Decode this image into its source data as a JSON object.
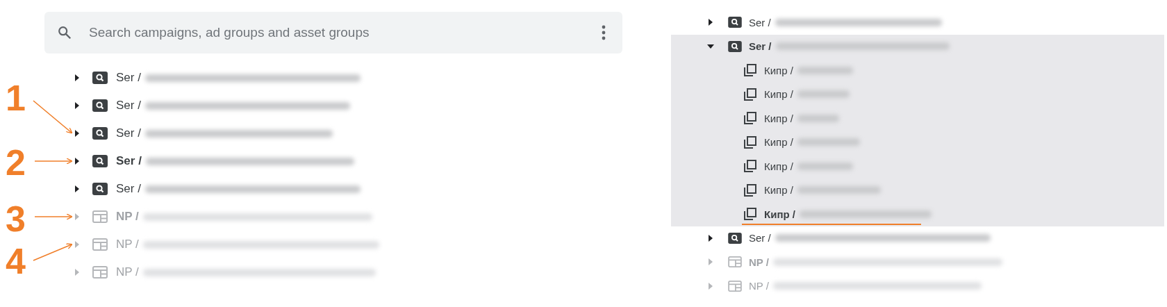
{
  "left_panel": {
    "search": {
      "placeholder": "Search campaigns, ad groups and asset groups"
    },
    "rows": [
      {
        "kind": "search",
        "prefix": "Ser /",
        "bold": false,
        "disabled": false,
        "expanded": false,
        "selected": false
      },
      {
        "kind": "search",
        "prefix": "Ser /",
        "bold": false,
        "disabled": false,
        "expanded": false,
        "selected": false
      },
      {
        "kind": "search",
        "prefix": "Ser /",
        "bold": false,
        "disabled": false,
        "expanded": false,
        "selected": false
      },
      {
        "kind": "search",
        "prefix": "Ser /",
        "bold": true,
        "disabled": false,
        "expanded": false,
        "selected": false
      },
      {
        "kind": "search",
        "prefix": "Ser /",
        "bold": false,
        "disabled": false,
        "expanded": false,
        "selected": false
      },
      {
        "kind": "display",
        "prefix": "NP /",
        "bold": true,
        "disabled": true,
        "expanded": false,
        "selected": false
      },
      {
        "kind": "display",
        "prefix": "NP /",
        "bold": false,
        "disabled": true,
        "expanded": false,
        "selected": false
      },
      {
        "kind": "display",
        "prefix": "NP /",
        "bold": false,
        "disabled": true,
        "expanded": false,
        "selected": false
      }
    ]
  },
  "annotations": [
    {
      "label": "1"
    },
    {
      "label": "2"
    },
    {
      "label": "3"
    },
    {
      "label": "4"
    }
  ],
  "right_panel": {
    "rows": [
      {
        "kind": "search",
        "prefix": "Ser /",
        "bold": false,
        "disabled": false,
        "expanded": false,
        "selected": false
      },
      {
        "kind": "search",
        "prefix": "Ser /",
        "bold": true,
        "disabled": false,
        "expanded": true,
        "selected": true,
        "children": [
          {
            "prefix": "Кипр /",
            "bold": false,
            "underlined": false
          },
          {
            "prefix": "Кипр /",
            "bold": false,
            "underlined": false
          },
          {
            "prefix": "Кипр /",
            "bold": false,
            "underlined": false
          },
          {
            "prefix": "Кипр /",
            "bold": false,
            "underlined": false
          },
          {
            "prefix": "Кипр /",
            "bold": false,
            "underlined": false
          },
          {
            "prefix": "Кипр /",
            "bold": false,
            "underlined": false
          },
          {
            "prefix": "Кипр /",
            "bold": true,
            "underlined": true
          }
        ]
      },
      {
        "kind": "search",
        "prefix": "Ser /",
        "bold": false,
        "disabled": false,
        "expanded": false,
        "selected": false
      },
      {
        "kind": "display",
        "prefix": "NP /",
        "bold": true,
        "disabled": true,
        "expanded": false,
        "selected": false
      },
      {
        "kind": "display",
        "prefix": "NP /",
        "bold": false,
        "disabled": true,
        "expanded": false,
        "selected": false
      }
    ]
  }
}
